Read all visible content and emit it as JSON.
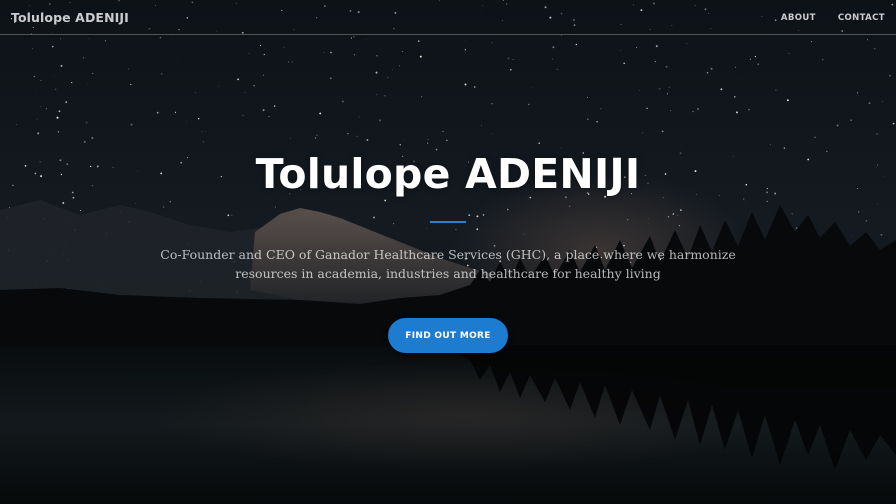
{
  "navbar": {
    "brand": "Tolulope ADENIJI",
    "links": [
      "ABOUT",
      "CONTACT"
    ]
  },
  "hero": {
    "heading": "Tolulope ADENIJI",
    "subtitle": "Co-Founder and CEO of Ganador Healthcare Services (GHC), a place where we harmonize resources in academia, industries and healthcare for healthy living",
    "cta_label": "FIND OUT MORE"
  },
  "colors": {
    "accent": "#1d7bd0",
    "divider": "#2283d8",
    "sky_top": "#0b1016",
    "text": "#ffffff"
  }
}
